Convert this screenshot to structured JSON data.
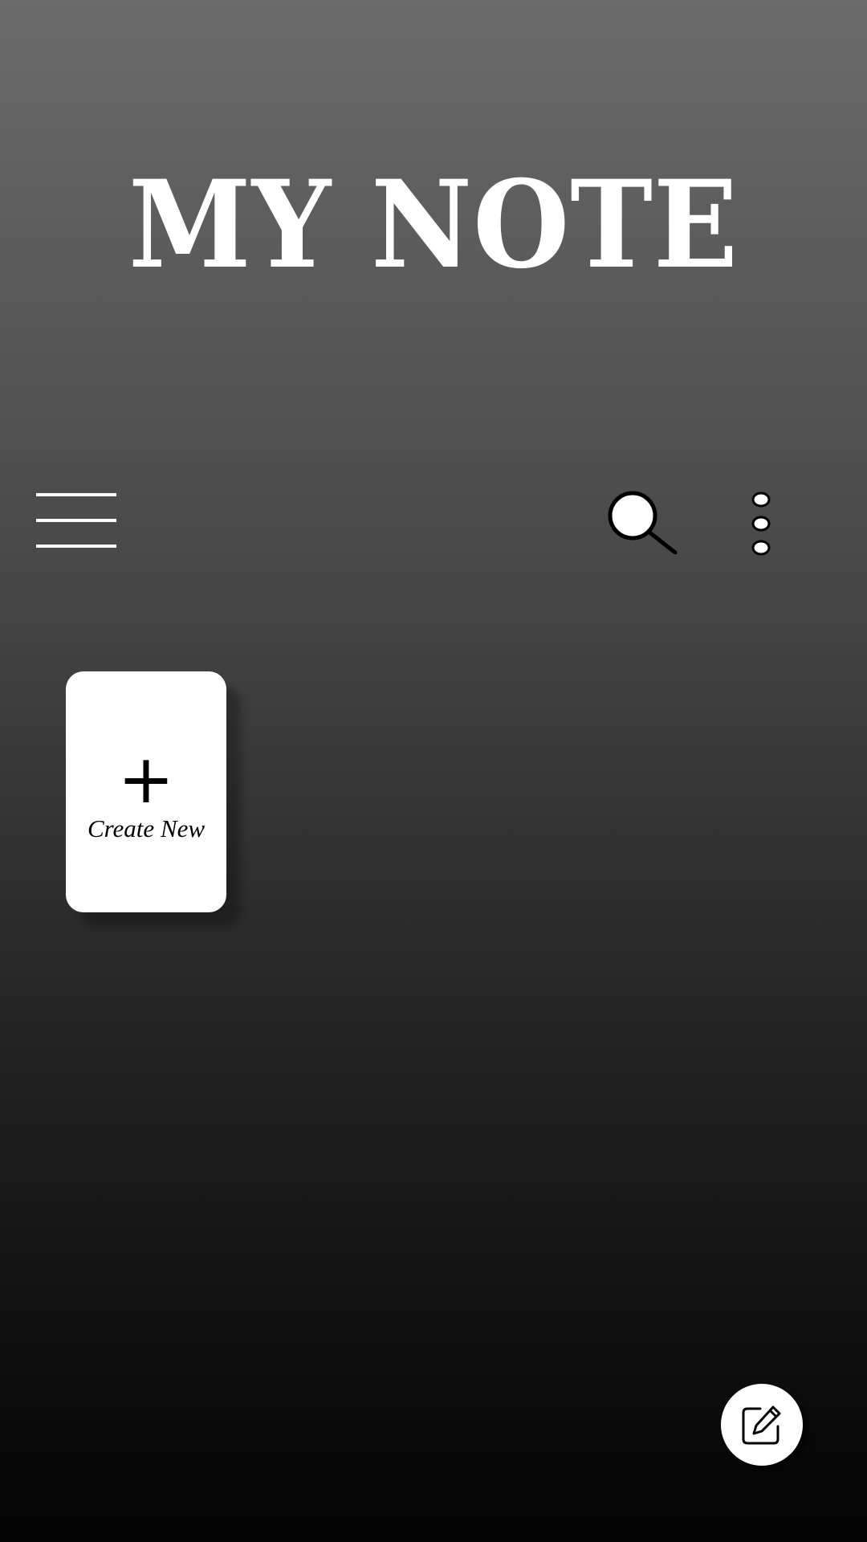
{
  "app": {
    "title": "MY NOTE"
  },
  "toolbar": {
    "menu_icon": "hamburger-menu-icon",
    "search_icon": "search-icon",
    "more_icon": "more-vertical-icon"
  },
  "create_card": {
    "plus_symbol": "+",
    "label": "Create New"
  },
  "fab": {
    "icon": "edit-note-icon"
  },
  "colors": {
    "background_top": "#6b6b6b",
    "background_bottom": "#030303",
    "card": "#ffffff",
    "text_primary": "#ffffff",
    "icon_stroke": "#000000"
  }
}
